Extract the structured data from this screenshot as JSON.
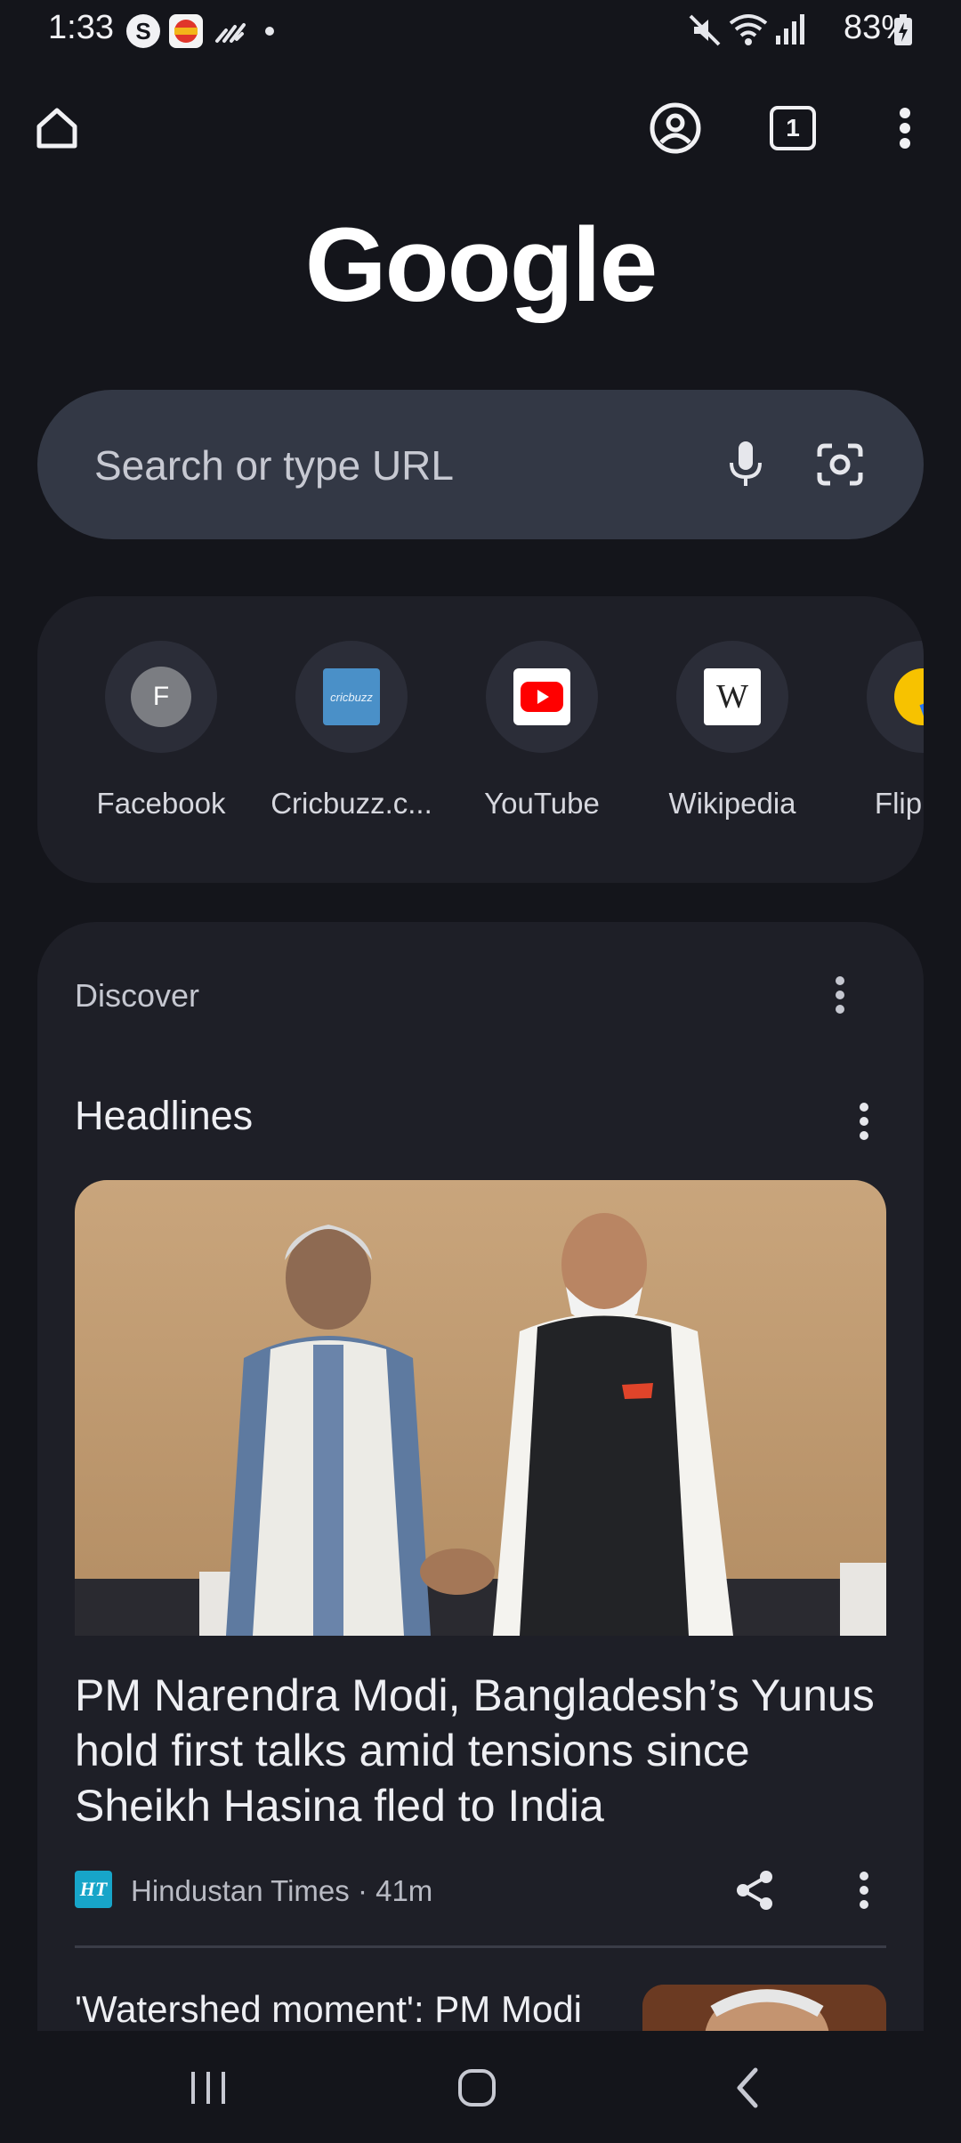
{
  "status_bar": {
    "time": "1:33",
    "battery": "83%",
    "icons": [
      "skype-icon",
      "app-icon",
      "activity-icon",
      "dot-icon",
      "mute-icon",
      "wifi-icon",
      "signal-icon",
      "battery-icon"
    ]
  },
  "toolbar": {
    "home_icon": "home-icon",
    "account_icon": "account-icon",
    "tab_count": "1",
    "menu_icon": "more-vert-icon"
  },
  "logo_text": "Google",
  "search": {
    "placeholder": "Search or type URL"
  },
  "shortcuts": [
    {
      "label": "Facebook",
      "initial": "F"
    },
    {
      "label": "Cricbuzz.c...",
      "initial": "cricbuzz"
    },
    {
      "label": "YouTube",
      "initial": ""
    },
    {
      "label": "Wikipedia",
      "initial": "W"
    },
    {
      "label": "Flipkart",
      "initial": ""
    }
  ],
  "discover": {
    "title": "Discover",
    "section": "Headlines",
    "article1": {
      "title": "PM Narendra Modi, Bangladesh’s Yunus hold first talks amid tensions since Sheikh Hasina fled to India",
      "source_logo": "HT",
      "source": "Hindustan Times · 41m"
    },
    "article2": {
      "title": "'Watershed moment': PM Modi"
    }
  },
  "colors": {
    "background": "#14151b",
    "card": "#1e1f27",
    "search": "#333845",
    "text": "#e6e7ec"
  }
}
